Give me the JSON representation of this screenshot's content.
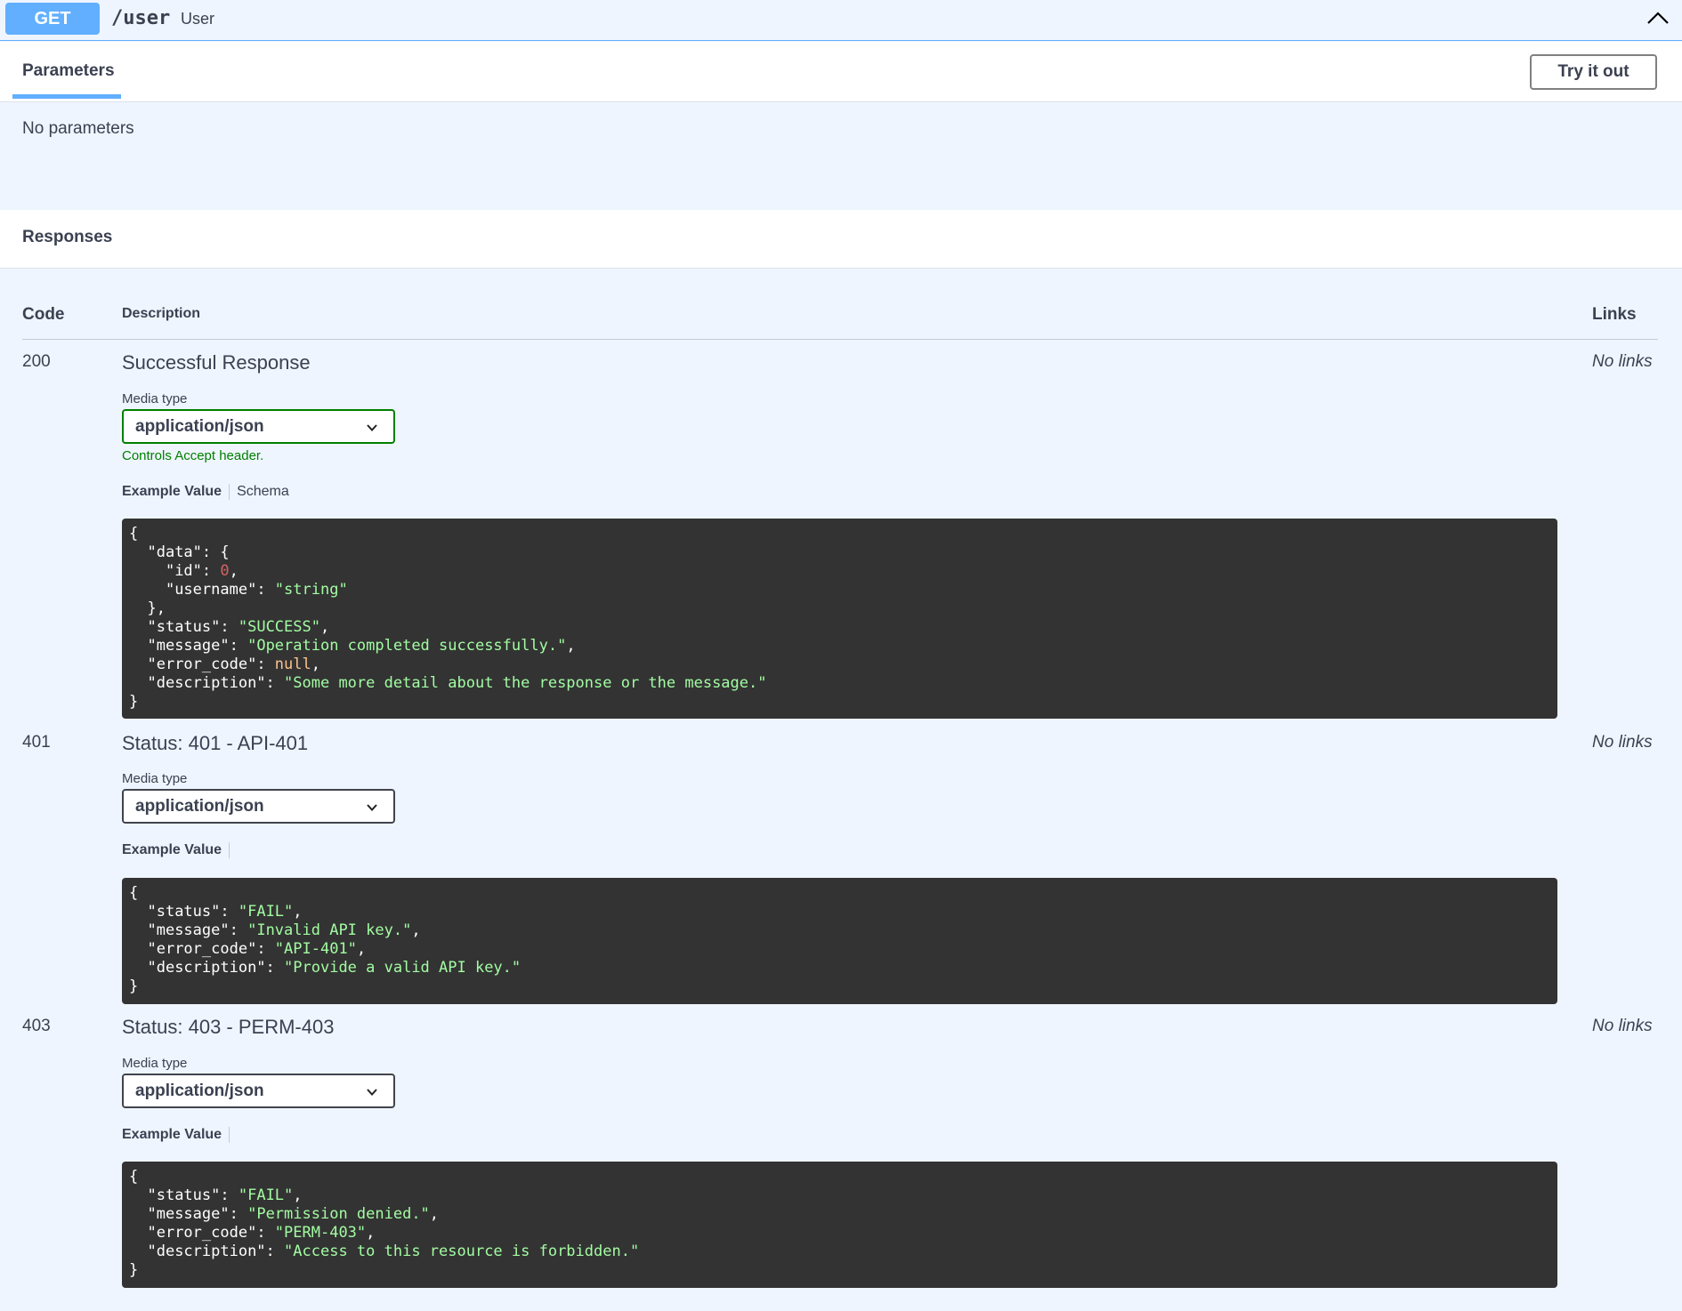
{
  "operation": {
    "method": "GET",
    "path": "/user",
    "summary": "User"
  },
  "tabs": {
    "parameters": "Parameters",
    "try_it_out": "Try it out",
    "no_parameters": "No parameters"
  },
  "responses": {
    "title": "Responses",
    "headers": {
      "code": "Code",
      "description": "Description",
      "links": "Links"
    },
    "media_type_label": "Media type",
    "controls_accept": "Controls Accept header.",
    "example_value": "Example Value",
    "schema": "Schema",
    "items": [
      {
        "code": "200",
        "description": "Successful Response",
        "links": "No links",
        "media_type": "application/json",
        "example": [
          "{",
          "  \"data\": {",
          "    \"id\": 0,",
          "    \"username\": \"string\"",
          "  },",
          "  \"status\": \"SUCCESS\",",
          "  \"message\": \"Operation completed successfully.\",",
          "  \"error_code\": null,",
          "  \"description\": \"Some more detail about the response or the message.\"",
          "}"
        ]
      },
      {
        "code": "401",
        "description": "Status: 401 - API-401",
        "links": "No links",
        "media_type": "application/json",
        "example": [
          "{",
          "  \"status\": \"FAIL\",",
          "  \"message\": \"Invalid API key.\",",
          "  \"error_code\": \"API-401\",",
          "  \"description\": \"Provide a valid API key.\"",
          "}"
        ]
      },
      {
        "code": "403",
        "description": "Status: 403 - PERM-403",
        "links": "No links",
        "media_type": "application/json",
        "example": [
          "{",
          "  \"status\": \"FAIL\",",
          "  \"message\": \"Permission denied.\",",
          "  \"error_code\": \"PERM-403\",",
          "  \"description\": \"Access to this resource is forbidden.\"",
          "}"
        ]
      }
    ]
  },
  "colors": {
    "get_method": "#61affe",
    "code_bg": "#333333",
    "string": "#a2fca2",
    "number": "#d36363",
    "null": "#fcc28c",
    "accept_hint": "#008000"
  },
  "icons": {
    "collapse": "chevron-up-icon",
    "select": "chevron-down-icon"
  }
}
